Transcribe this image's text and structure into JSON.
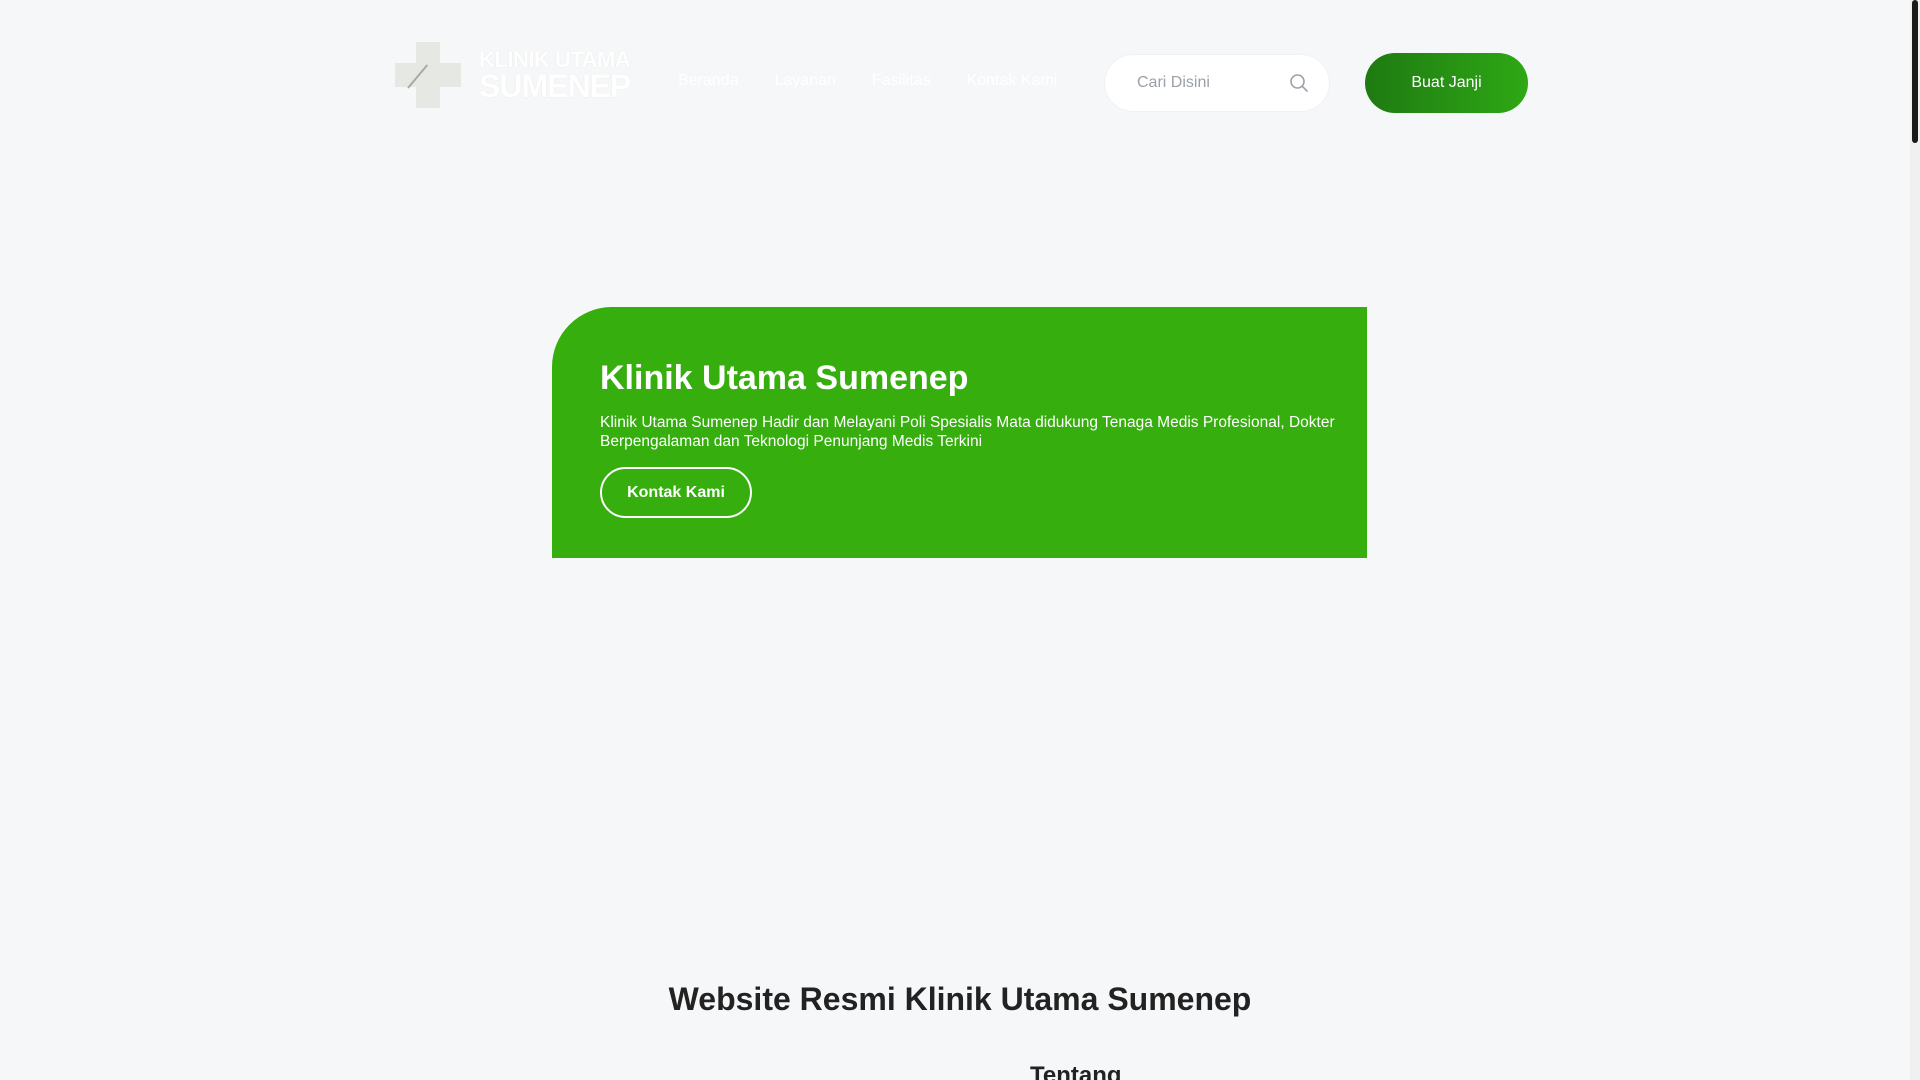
{
  "header": {
    "logo": {
      "line1": "KLINIK UTAMA",
      "line2": "SUMENEP"
    },
    "nav": [
      {
        "label": "Beranda"
      },
      {
        "label": "Layanan"
      },
      {
        "label": "Fasilitas"
      },
      {
        "label": "Kontak Kami"
      }
    ],
    "search": {
      "placeholder": "Cari Disini",
      "icon": "search-icon"
    },
    "cta_label": "Buat Janji"
  },
  "hero": {
    "title": "Klinik Utama Sumenep",
    "description": "Klinik Utama Sumenep Hadir dan Melayani Poli Spesialis Mata didukung Tenaga Medis Profesional, Dokter Berpengalaman dan Teknologi Penunjang Medis Terkini",
    "button_label": "Kontak Kami"
  },
  "content": {
    "section_title": "Website Resmi Klinik Utama Sumenep",
    "sub_heading": "Tentang"
  },
  "colors": {
    "brand_green": "#35ae0e",
    "cta_dark": "#1f7a12",
    "background": "#f6f7f9"
  }
}
